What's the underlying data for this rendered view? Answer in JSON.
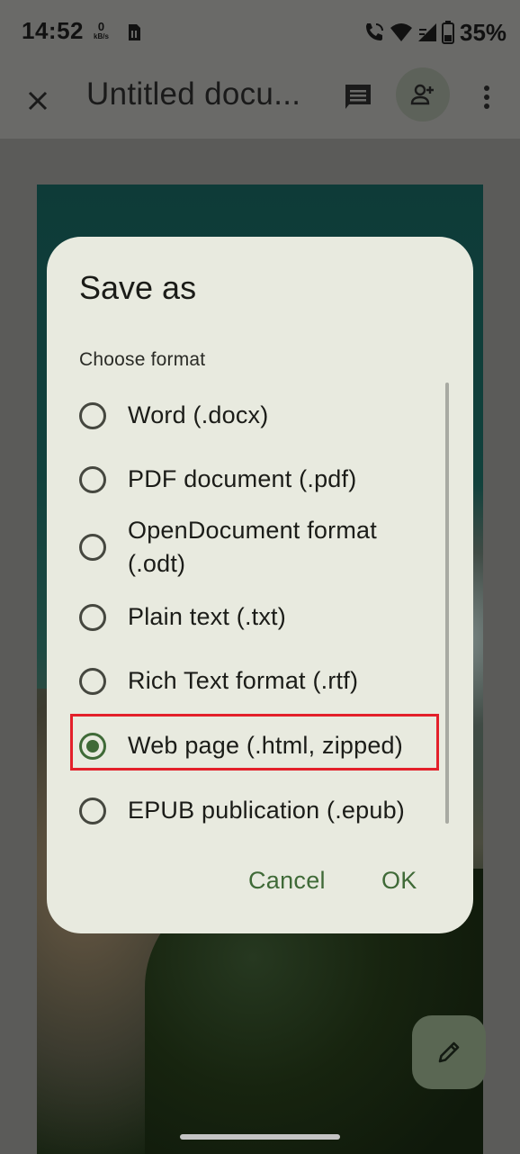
{
  "status_bar": {
    "time": "14:52",
    "net_speed_value": "0",
    "net_speed_unit": "kB/s",
    "battery": "35%",
    "icons": [
      "sim-card-icon",
      "wifi-calling-icon",
      "wifi-icon",
      "signal-icon",
      "battery-icon"
    ]
  },
  "app_bar": {
    "title": "Untitled docu...",
    "icons": [
      "close-icon",
      "comment-icon",
      "add-person-icon",
      "more-vert-icon"
    ]
  },
  "dialog": {
    "title": "Save as",
    "subtitle": "Choose format",
    "options": [
      {
        "label": "Word (.docx)",
        "selected": false
      },
      {
        "label": "PDF document (.pdf)",
        "selected": false
      },
      {
        "label": "OpenDocument format (.odt)",
        "selected": false
      },
      {
        "label": "Plain text (.txt)",
        "selected": false
      },
      {
        "label": "Rich Text format (.rtf)",
        "selected": false
      },
      {
        "label": "Web page (.html, zipped)",
        "selected": true
      },
      {
        "label": "EPUB publication (.epub)",
        "selected": false
      }
    ],
    "cancel_label": "Cancel",
    "ok_label": "OK"
  },
  "fab": {
    "icon": "edit-pencil-icon"
  },
  "colors": {
    "accent": "#3f6a37",
    "highlight_box": "#e3202a",
    "dialog_bg": "#e8eadf"
  }
}
